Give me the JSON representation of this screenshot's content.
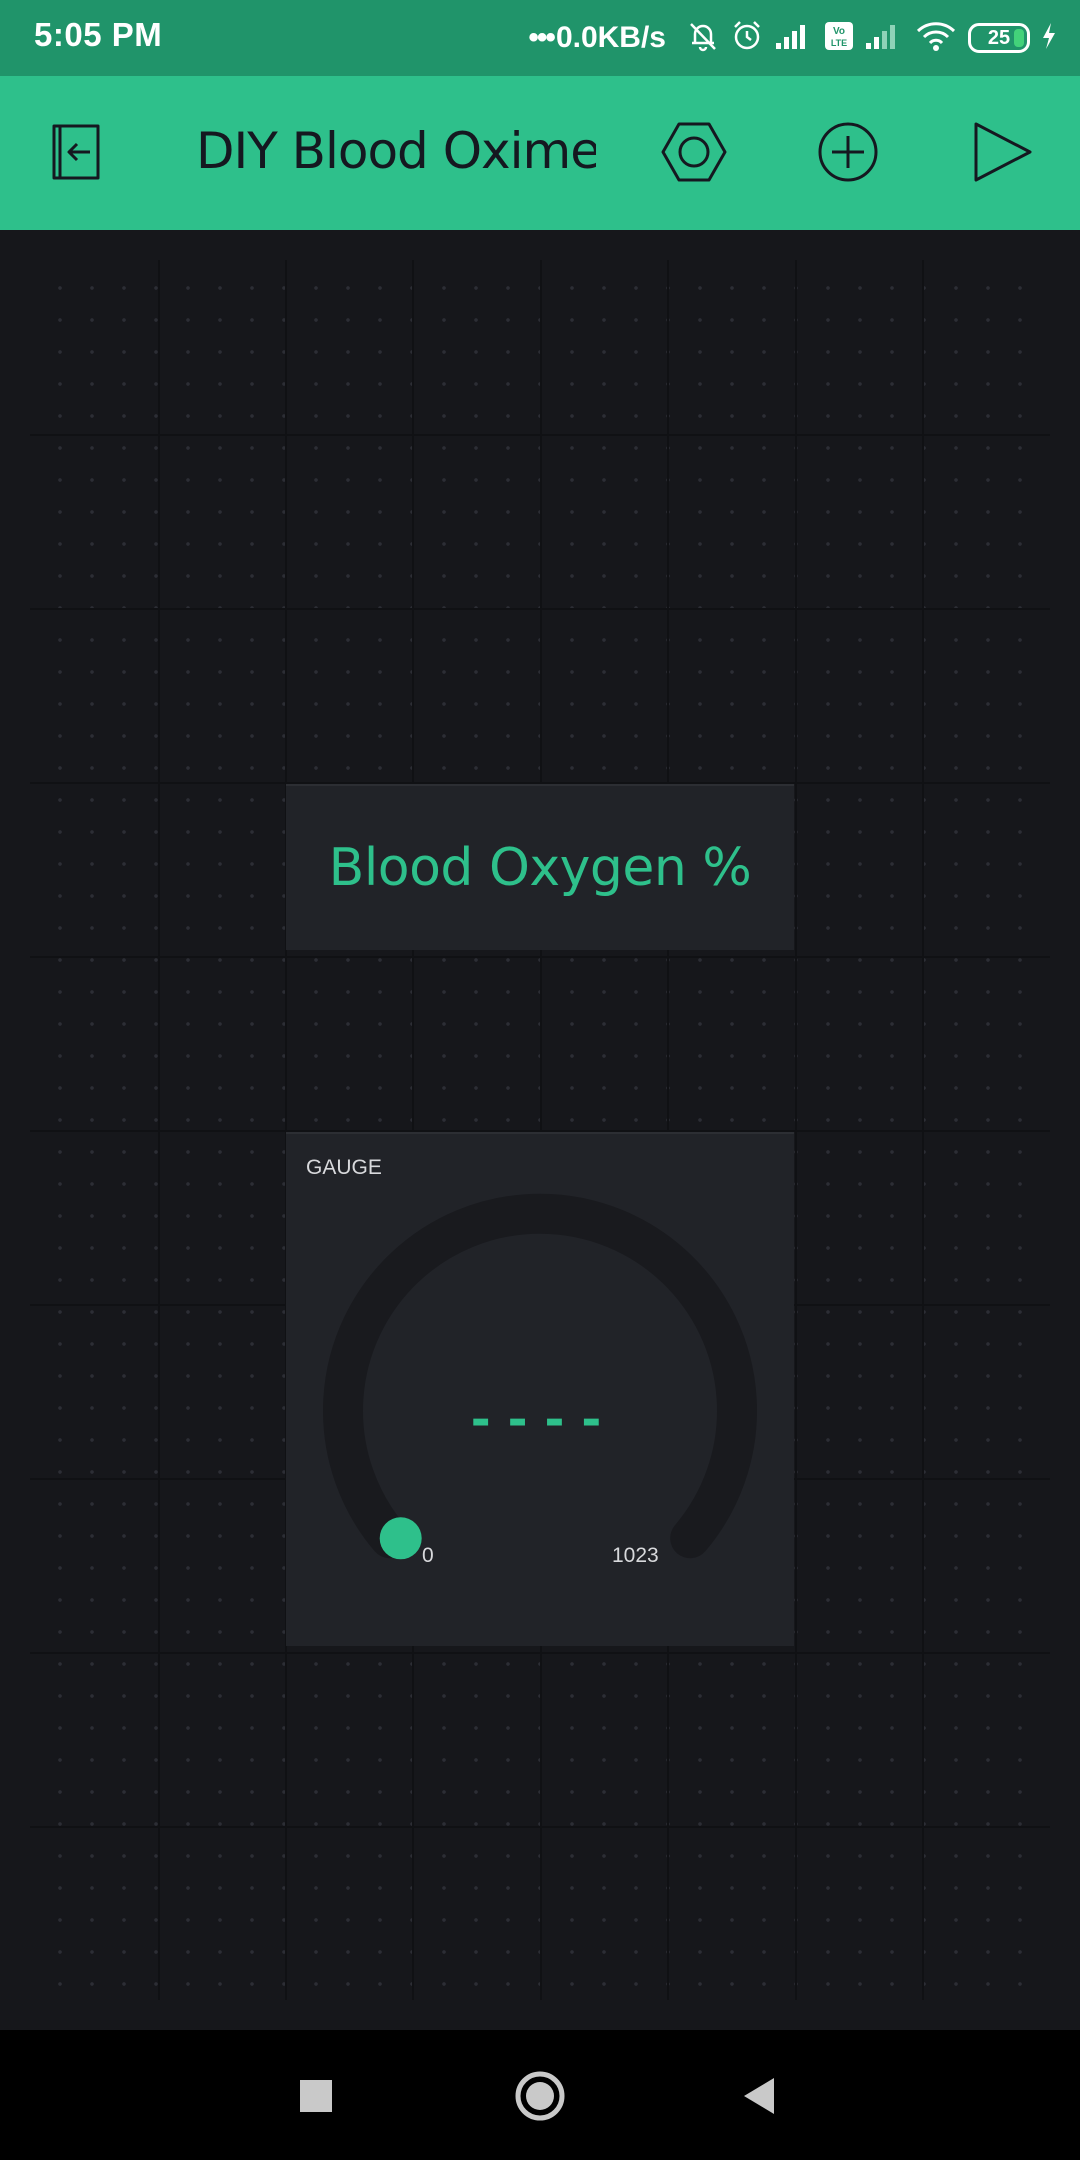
{
  "status_bar": {
    "time": "5:05 PM",
    "dots": "•••",
    "network_speed": "0.0KB/s",
    "battery_level": "25",
    "icons": [
      "muted-bell-icon",
      "alarm-icon",
      "signal-icon",
      "volte-icon",
      "signal-icon",
      "wifi-icon",
      "battery-icon",
      "charging-icon"
    ]
  },
  "toolbar": {
    "title": "DIY Blood Oximete",
    "icons": [
      "exit-icon",
      "settings-hexagon-icon",
      "add-icon",
      "play-icon"
    ],
    "background_color": "#2ec08b"
  },
  "widgets": {
    "label": {
      "text": "Blood Oxygen %"
    },
    "gauge": {
      "title": "GAUGE",
      "value": "----",
      "min": "0",
      "max": "1023",
      "level": 0,
      "accent_color": "#2ec08b"
    }
  },
  "nav_bar": {
    "icons": [
      "recent-apps-icon",
      "home-icon",
      "back-icon"
    ]
  }
}
